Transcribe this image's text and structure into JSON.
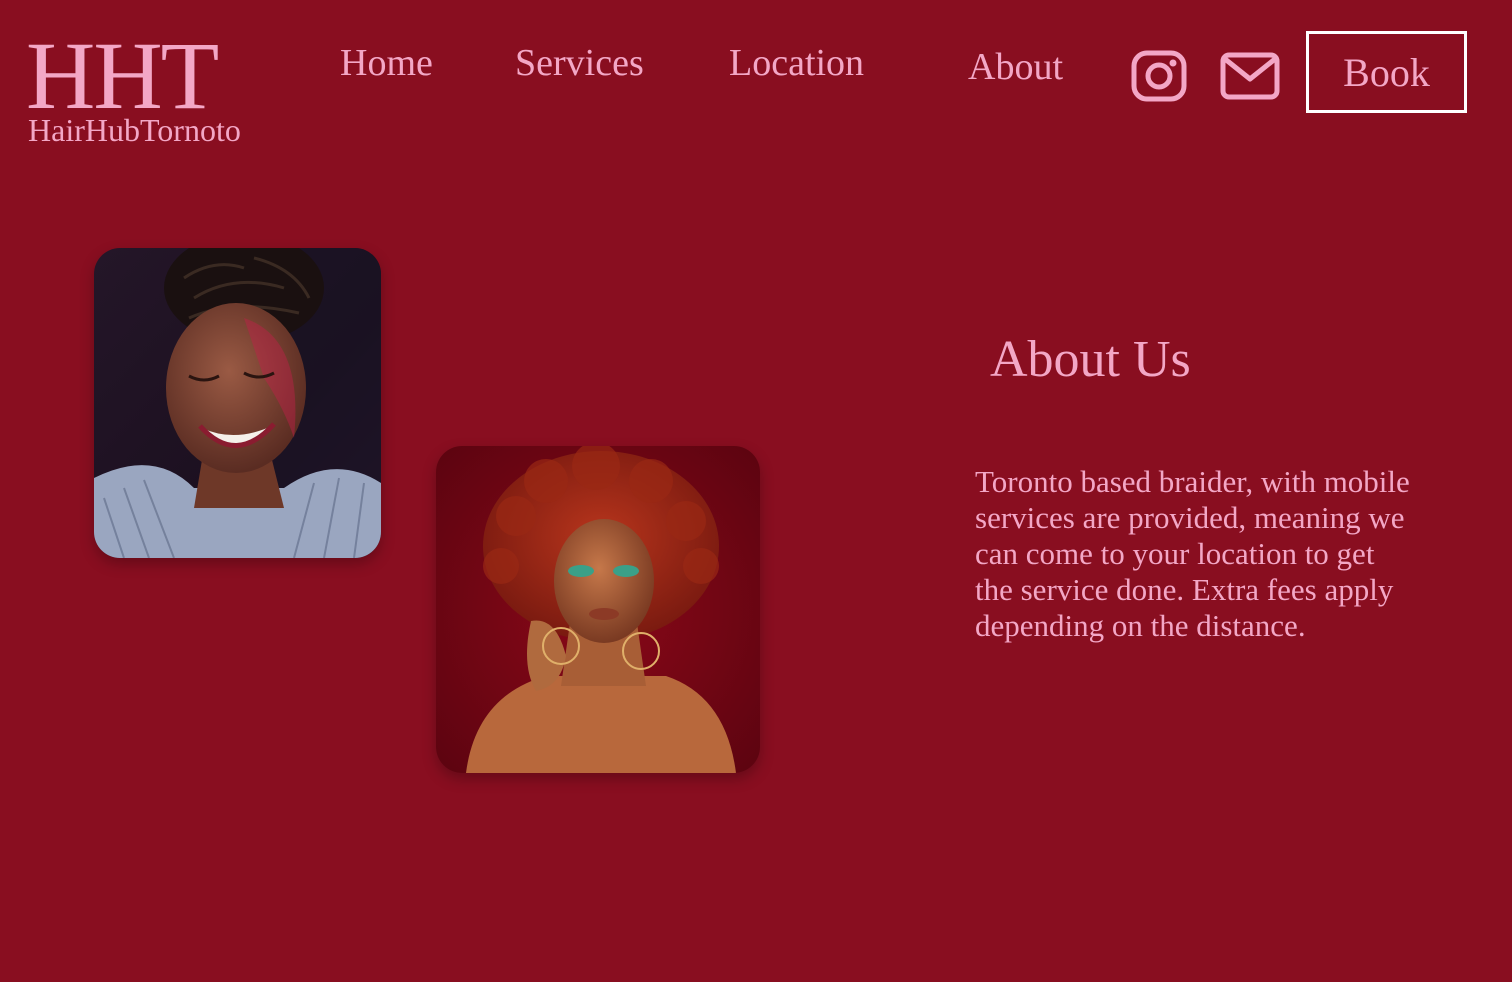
{
  "brand": {
    "mark": "HHT",
    "name": "HairHubTornoto"
  },
  "nav": {
    "home": "Home",
    "services": "Services",
    "location": "Location",
    "about": "About"
  },
  "social": {
    "instagram_icon": "instagram-icon",
    "mail_icon": "mail-icon"
  },
  "book_label": "Book",
  "about": {
    "title": "About Us",
    "body": "Toronto based braider, with mobile services are provided, meaning we can come to your location to get the service done. Extra fees apply depending on the distance."
  },
  "colors": {
    "background": "#890e20",
    "accent_pink": "#f3a7c6",
    "button_border": "#ffffff"
  }
}
